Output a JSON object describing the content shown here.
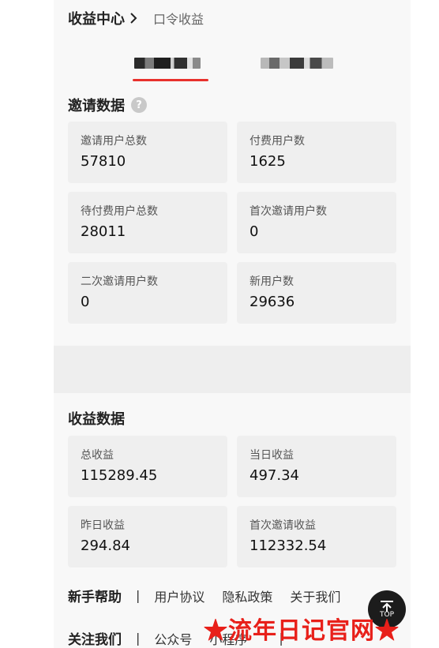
{
  "header": {
    "title": "收益中心",
    "subtitle": "口令收益"
  },
  "invite_section": {
    "title": "邀请数据",
    "help_icon_text": "?",
    "cards": [
      {
        "label": "邀请用户总数",
        "value": "57810"
      },
      {
        "label": "付费用户数",
        "value": "1625"
      },
      {
        "label": "待付费用户总数",
        "value": "28011"
      },
      {
        "label": "首次邀请用户数",
        "value": "0"
      },
      {
        "label": "二次邀请用户数",
        "value": "0"
      },
      {
        "label": "新用户数",
        "value": "29636"
      }
    ]
  },
  "earnings_section": {
    "title": "收益数据",
    "cards": [
      {
        "label": "总收益",
        "value": "115289.45"
      },
      {
        "label": "当日收益",
        "value": "497.34"
      },
      {
        "label": "昨日收益",
        "value": "294.84"
      },
      {
        "label": "首次邀请收益",
        "value": "112332.54"
      }
    ]
  },
  "footer": {
    "row1": {
      "title": "新手帮助",
      "sep": "|",
      "links": [
        "用户协议",
        "隐私政策",
        "关于我们"
      ]
    },
    "row2": {
      "title": "关注我们",
      "sep": "|",
      "links": [
        "公众号",
        "小程序"
      ],
      "tail_sep": "|"
    }
  },
  "top_button": {
    "text": "TOP"
  },
  "watermark": "★流年日记官网★",
  "colors": {
    "accent": "#e8312d",
    "watermark": "#e8201a",
    "card_bg": "#efefef"
  }
}
